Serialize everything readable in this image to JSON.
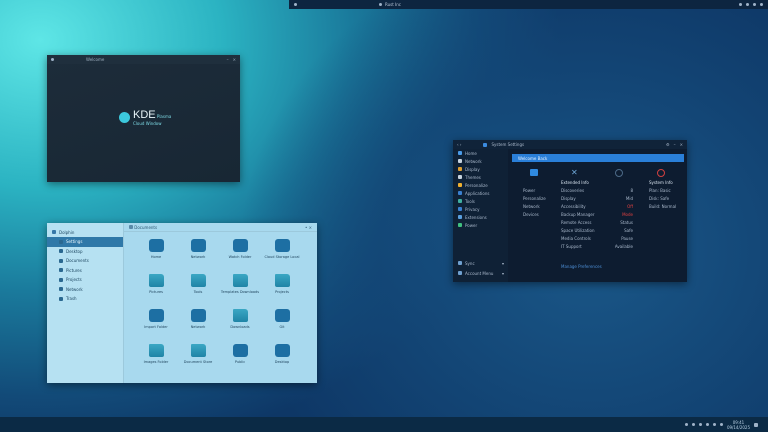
{
  "top_panel": {
    "title": "Rust Inc"
  },
  "kde_window": {
    "title": "Welcome",
    "logo_text": "KDE",
    "logo_tag": "Plasma",
    "subtitle": "Cloud Window"
  },
  "settings_window": {
    "title": "System Settings",
    "sidebar": [
      "Home",
      "Network",
      "Display",
      "Themes",
      "Personalize",
      "Applications",
      "Tools",
      "Privacy",
      "Extensions",
      "Power"
    ],
    "sidebar_footer": [
      "Sync",
      "Account Menu"
    ],
    "banner": "Welcome Back",
    "left_col": [
      "Power",
      "Personalize",
      "Network",
      "Devices"
    ],
    "mid_header": "Extended Info",
    "mid_rows": [
      [
        "Discoveries",
        "8"
      ],
      [
        "Display",
        "Mid"
      ],
      [
        "Accessibility",
        "Off"
      ],
      [
        "Backup Manager",
        "Mode"
      ],
      [
        "Remote Access",
        "Status"
      ],
      [
        "Space Utilization",
        "Safe"
      ],
      [
        "Media Controls",
        "Pause"
      ],
      [
        "IT Support",
        "Available"
      ]
    ],
    "right_header": "System Info",
    "right_rows": [
      "Plan: Basic",
      "Disk: Safe",
      "Build: Normal"
    ],
    "footer_link": "Manage Preferences"
  },
  "files_window": {
    "title": "Dolphin",
    "path": "Documents",
    "sidebar": [
      "Settings",
      "Desktop",
      "Documents",
      "Pictures",
      "Projects",
      "Network",
      "Trash"
    ],
    "items": [
      "Home",
      "Network",
      "Watch Folder",
      "Cloud Storage Local",
      "Pictures",
      "Tools",
      "Templates Downloads",
      "Projects",
      "Import Folder",
      "Network",
      "Downloads",
      "Git",
      "Images Folder",
      "Document Store",
      "Public",
      "Desktop"
    ]
  },
  "taskbar": {
    "time": "09:41",
    "date": "09/14/2025"
  }
}
